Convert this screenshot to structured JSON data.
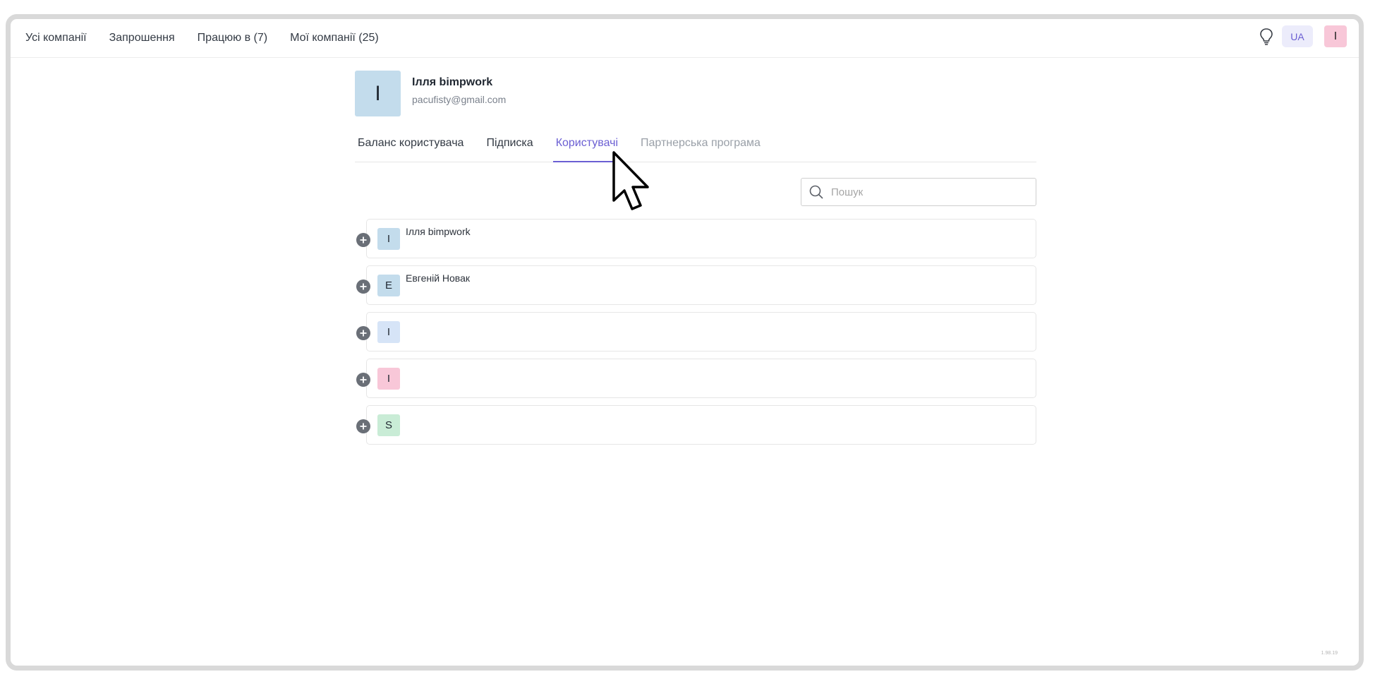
{
  "nav": {
    "items": [
      "Усі компанії",
      "Запрошення",
      "Працюю в (7)",
      "Мої компанії (25)"
    ]
  },
  "header": {
    "language": "UA",
    "user_initial": "I",
    "hint_icon": "lightbulb-icon"
  },
  "profile": {
    "initial": "I",
    "name": "Ілля bimpwork",
    "email": "pacufisty@gmail.com"
  },
  "tabs": [
    {
      "label": "Баланс користувача",
      "state": "normal"
    },
    {
      "label": "Підписка",
      "state": "normal"
    },
    {
      "label": "Користувачі",
      "state": "active"
    },
    {
      "label": "Партнерська програма",
      "state": "disabled"
    }
  ],
  "search": {
    "placeholder": "Пошук",
    "value": ""
  },
  "users": [
    {
      "initial": "I",
      "name": "Ілля bimpwork",
      "color": "#c3dcec"
    },
    {
      "initial": "E",
      "name": "Евгеній Новак",
      "color": "#c3dcec"
    },
    {
      "initial": "I",
      "name": "",
      "color": "#d6e4f7"
    },
    {
      "initial": "I",
      "name": "",
      "color": "#f8c7d8"
    },
    {
      "initial": "S",
      "name": "",
      "color": "#c9ecd6"
    }
  ],
  "colors": {
    "accent": "#6b5fd3",
    "lang_bg": "#ececfb",
    "top_avatar_bg": "#f8c7d8",
    "profile_avatar_bg": "#c3dcec"
  },
  "version": "1.98.19"
}
